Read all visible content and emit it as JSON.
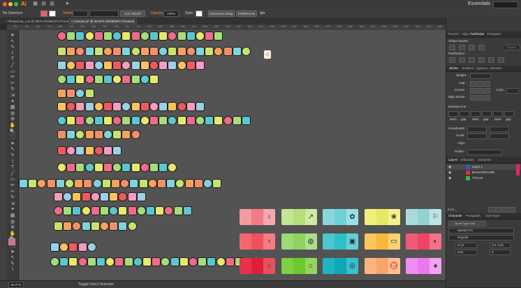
{
  "app": {
    "logo": "Ai",
    "workspace": "Essentials"
  },
  "control_bar": {
    "selection": "No Selection",
    "stroke_label": "Stroke:",
    "brush": "5 pt. Round",
    "opacity_label": "Opacity:",
    "opacity": "100%",
    "style_label": "Style:",
    "doc_setup": "Document Setup",
    "preferences": "Preferences"
  },
  "tabs": [
    {
      "label": "Weaponsa_1.ai @ 300% (RGB/GPU Preview)",
      "close": "×"
    },
    {
      "label": "Canvas.ai* @ 66.67% (RGB/GPU Preview)",
      "close": "×"
    }
  ],
  "ruler_ticks": [
    "-794",
    "-792",
    "-784",
    "-776",
    "-768",
    "-760",
    "-752",
    "-744",
    "-736",
    "-728",
    "-720",
    "-712",
    "-704",
    "-696",
    "-688",
    "-680",
    "-672",
    "-664",
    "-656",
    "-648",
    "-640",
    "-632",
    "-624",
    "-616",
    "-608",
    "-600",
    "-592",
    "-584",
    "-576",
    "-568",
    "-560",
    "-552",
    "-544",
    "-536",
    "-528",
    "-520",
    "-512",
    "-504",
    "-496"
  ],
  "status": {
    "zoom": "66.67%",
    "text": "Toggle Direct Selection"
  },
  "panels": {
    "top_tabs": [
      "Transfor",
      "Align",
      "Pathfinder",
      "Transpare"
    ],
    "shape_modes": "Shape Modes:",
    "expand": "Expand",
    "pathfinders": "Pathfinders:",
    "stroke_tabs": [
      "Stroke",
      "Gradient",
      "Appeara",
      "Libraries"
    ],
    "stroke_fields": [
      "Weight:",
      "Cap:",
      "Corner:",
      "Limit:",
      "Align Stroke:"
    ],
    "dashed_line": "Dashed Line",
    "dash_labels": [
      "dash",
      "gap",
      "dash",
      "gap",
      "dash",
      "gap"
    ],
    "arrowheads": "Arrowheads:",
    "scale": "Scale:",
    "align": "Align:",
    "profile": "Profile:",
    "layers_tabs": [
      "Layers",
      "Artboards",
      "Swatches"
    ],
    "layers": [
      "Layer 1",
      "BACKGROUND",
      "TITLAS"
    ],
    "layer_count": "3 La...",
    "char_tabs": [
      "Character",
      "Paragraph",
      "OpenType"
    ],
    "touch_type": "Touch Type Tool",
    "font": "Myriad Pro",
    "font_style": "Regular",
    "font_size": "12 pt",
    "leading": "(14.4 pt)",
    "kerning": "Auto",
    "tracking": "0"
  },
  "palette_cards": [
    {
      "colors": [
        "#f59aa1",
        "#f07c86",
        "#f6a8ae"
      ],
      "glyph": "♁"
    },
    {
      "colors": [
        "#c3e694",
        "#b5df7a",
        "#cdeaa3"
      ],
      "glyph": "↗"
    },
    {
      "colors": [
        "#86d8de",
        "#6fd0d7",
        "#9adfe4"
      ],
      "glyph": "✿"
    },
    {
      "colors": [
        "#eef07c",
        "#e6e865",
        "#f1f28f"
      ],
      "glyph": "❀"
    },
    {
      "colors": [
        "#a8dcdb",
        "#95d3d2",
        "#bde3e3"
      ],
      "glyph": "⚐"
    },
    {
      "colors": [
        "#f2676f",
        "#ee525c",
        "#f47c83"
      ],
      "glyph": "♁"
    },
    {
      "colors": [
        "#9ed977",
        "#8fd262",
        "#acdf8a"
      ],
      "glyph": "◍"
    },
    {
      "colors": [
        "#49c9cf",
        "#2fbfc6",
        "#63d0d5"
      ],
      "glyph": "▣"
    },
    {
      "colors": [
        "#f9c65a",
        "#f7b83e",
        "#fbd173"
      ],
      "glyph": "▭"
    },
    {
      "colors": [
        "#f05a76",
        "#ec4565",
        "#f37189"
      ],
      "glyph": "◐"
    },
    {
      "colors": [
        "#e4334a",
        "#de1f3a",
        "#e8505f"
      ],
      "glyph": "⌂"
    },
    {
      "colors": [
        "#7fcf44",
        "#6dc72e",
        "#92d75d"
      ],
      "glyph": "⌂"
    },
    {
      "colors": [
        "#20b3c4",
        "#0fa8ba",
        "#3cbfcd"
      ],
      "glyph": "◎"
    },
    {
      "colors": [
        "#fbb47f",
        "#f9a469",
        "#fcc297"
      ],
      "glyph": "♉"
    },
    {
      "colors": [
        "#ef8df0",
        "#eb78ec",
        "#f2a1f3"
      ],
      "glyph": "♠"
    }
  ],
  "icon_palette": [
    "#ef6b8b",
    "#f8c35b",
    "#7fd3dc",
    "#a6dc7a",
    "#f05a5f",
    "#c5e36e",
    "#5bc6d0",
    "#f49cc0",
    "#f7a25b",
    "#e8e86a",
    "#9ad0e8",
    "#f28f6b"
  ],
  "colors": {
    "canvas": "#535353",
    "panel": "#3a3a3a",
    "accent": "#ff8a2a",
    "fill_swatch": "#e06a8a"
  }
}
